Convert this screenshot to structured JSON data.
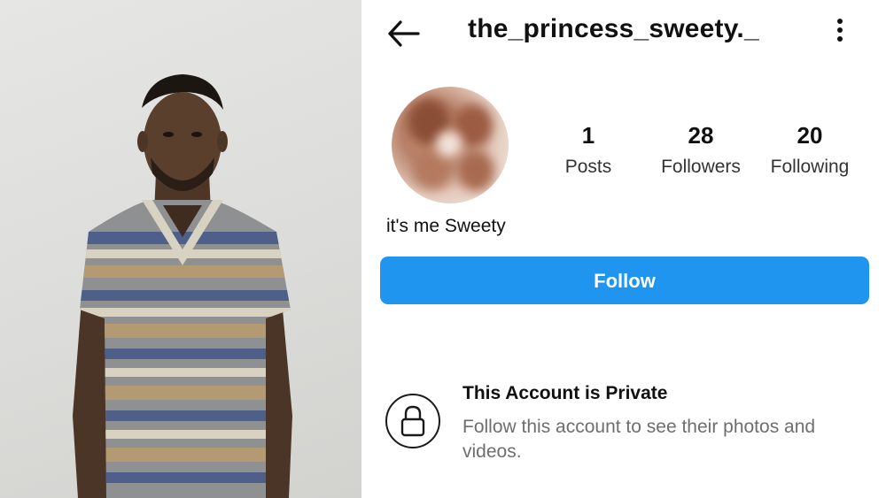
{
  "photo": {
    "subject": "photo-of-man-in-striped-tshirt"
  },
  "profile": {
    "header": {
      "back_icon": "arrow-left-icon",
      "username": "the_princess_sweety._",
      "more_icon": "more-vertical-icon"
    },
    "avatar": {
      "blurred": true
    },
    "stats": {
      "posts": {
        "value": "1",
        "label": "Posts"
      },
      "followers": {
        "value": "28",
        "label": "Followers"
      },
      "following": {
        "value": "20",
        "label": "Following"
      }
    },
    "bio": "it's me Sweety",
    "follow_button": {
      "label": "Follow",
      "color": "#1f95ef"
    },
    "private_notice": {
      "icon": "lock-icon",
      "title": "This Account is Private",
      "text": "Follow this account to see their photos and videos."
    }
  }
}
